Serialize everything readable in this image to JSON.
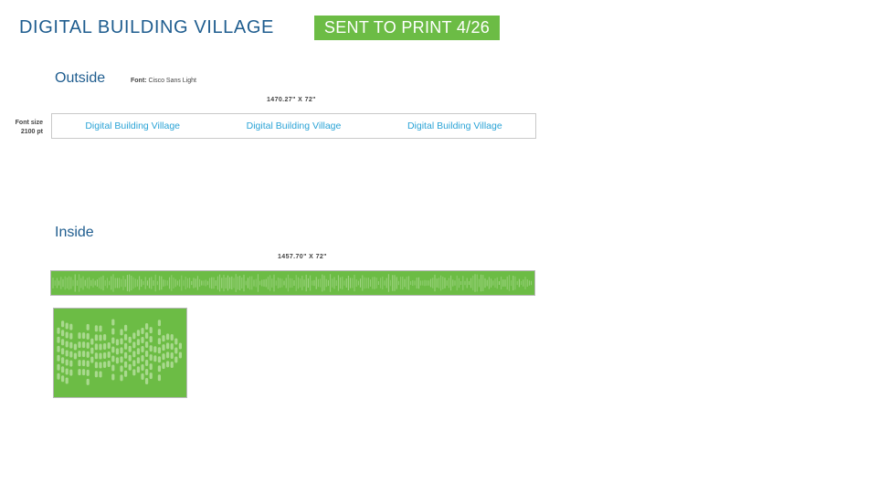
{
  "header": {
    "title": "DIGITAL BUILDING VILLAGE",
    "badge": "SENT TO PRINT 4/26"
  },
  "outside": {
    "label": "Outside",
    "font_note_label": "Font:",
    "font_note_value": "Cisco Sans Light",
    "dimensions": "1470.27\" X 72\"",
    "font_size_label": "Font size",
    "font_size_value": "2100 pt",
    "banner_texts": [
      "Digital Building Village",
      "Digital Building Village",
      "Digital Building Village"
    ]
  },
  "inside": {
    "label": "Inside",
    "dimensions": "1457.70\" X 72\""
  },
  "colors": {
    "brand_green": "#6cbc45",
    "title_blue": "#1f5d8f",
    "banner_text_blue": "#2aa3d6",
    "pattern_light": "#a9d98e"
  }
}
